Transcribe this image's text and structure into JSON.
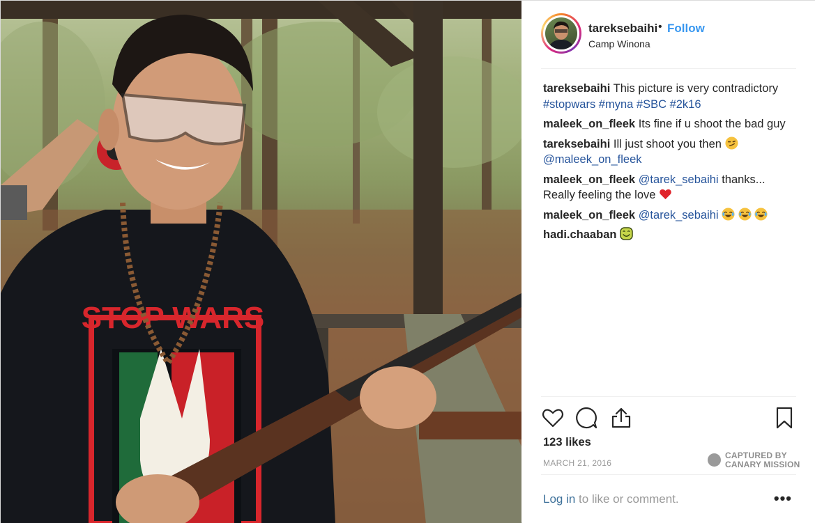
{
  "post": {
    "author": "tareksebaihi",
    "separator": "•",
    "follow_label": "Follow",
    "location": "Camp Winona",
    "shirt_text": "STOP WARS"
  },
  "comments": [
    {
      "user": "tareksebaihi",
      "text": "This picture is very contradictory",
      "tags": "#stopwars #myna #SBC #2k16"
    },
    {
      "user": "maleek_on_fleek",
      "text": "Its fine if u shoot the bad guy"
    },
    {
      "user": "tareksebaihi",
      "text": "Ill just shoot you then",
      "emoji": "smirk-emoji",
      "tags": "@maleek_on_fleek"
    },
    {
      "user": "maleek_on_fleek",
      "mention": "@tarek_sebaihi",
      "text": "thanks... Really feeling the love",
      "emoji": "red-heart-emoji"
    },
    {
      "user": "maleek_on_fleek",
      "mention": "@tarek_sebaihi",
      "emoji": "joy-emoji x3"
    },
    {
      "user": "hadi.chaaban",
      "emoji": "happy-face-emoji"
    }
  ],
  "actions": {
    "like_icon": "heart-icon",
    "comment_icon": "comment-icon",
    "share_icon": "share-icon",
    "save_icon": "bookmark-icon"
  },
  "likes": "123 likes",
  "date": "MARCH 21, 2016",
  "watermark": {
    "line1": "CAPTURED BY",
    "line2": "CANARY MISSION"
  },
  "footer": {
    "login_link": "Log in",
    "login_rest": " to like or comment.",
    "more": "•••"
  },
  "colors": {
    "link": "#3897f0",
    "text": "#262626",
    "muted": "#999999",
    "tag": "#26549b"
  }
}
